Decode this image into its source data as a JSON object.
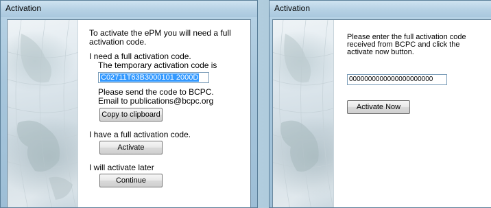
{
  "left_dialog": {
    "title": "Activation",
    "intro": [
      "To activate the ePM you will need a full",
      "activation code."
    ],
    "need_code_heading": "I need a full activation code.",
    "temp_code_label": "The temporary activation code is",
    "temp_code_value": "C02711T63B3000101 2000D",
    "send_text": "Please send the code to BCPC.",
    "email_text": "Email to   publications@bcpc.org",
    "copy_button": "Copy to clipboard",
    "have_code_heading": "I have a full activation code.",
    "activate_button": "Activate",
    "later_heading": "I will activate later",
    "continue_button": "Continue"
  },
  "right_dialog": {
    "title": "Activation",
    "instructions": [
      "Please enter the full activation code",
      "received from BCPC and click the",
      "activate now button."
    ],
    "code_input_value": "0000000000000000000000",
    "activate_now_button": "Activate Now"
  }
}
